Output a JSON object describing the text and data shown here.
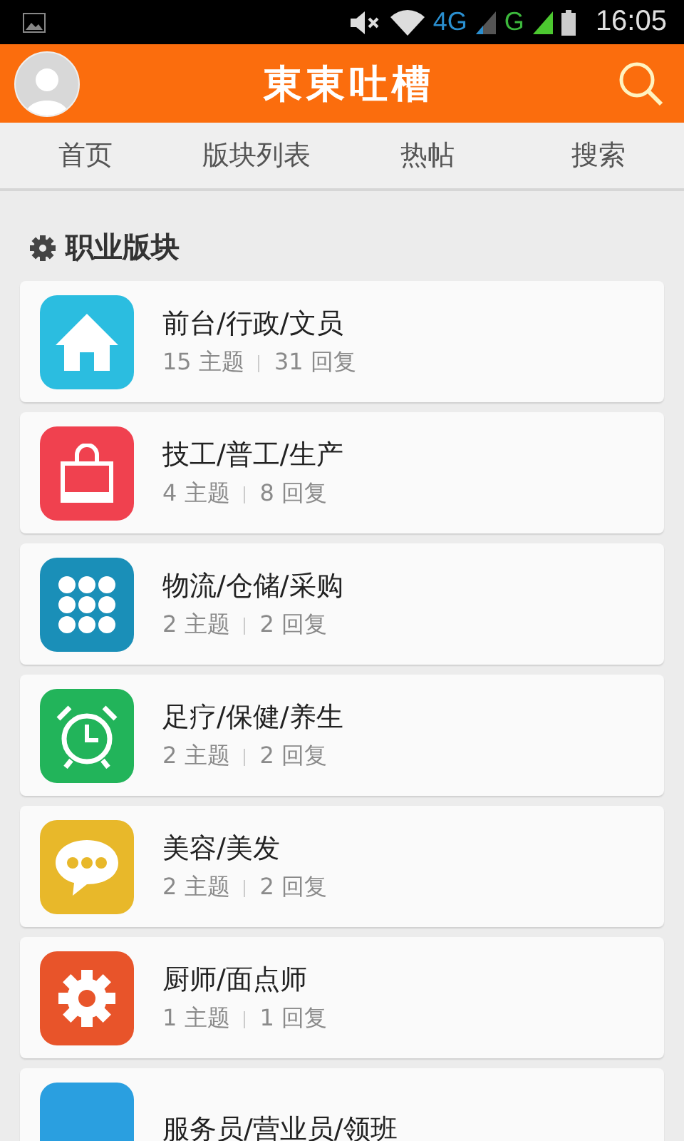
{
  "status_bar": {
    "network_1": "4G",
    "network_2": "G",
    "time": "16:05"
  },
  "header": {
    "title": "東東吐槽"
  },
  "tabs": [
    {
      "label": "首页"
    },
    {
      "label": "版块列表"
    },
    {
      "label": "热帖"
    },
    {
      "label": "搜索"
    }
  ],
  "section": {
    "title": "职业版块"
  },
  "forums": [
    {
      "kind": "house",
      "color": "#2bbde0",
      "name": "前台/行政/文员",
      "topics": "15 主题",
      "replies": "31 回复"
    },
    {
      "kind": "bag",
      "color": "#f0414f",
      "name": "技工/普工/生产",
      "topics": "4 主题",
      "replies": "8 回复"
    },
    {
      "kind": "grid",
      "color": "#1a8fb8",
      "name": "物流/仓储/采购",
      "topics": "2 主题",
      "replies": "2 回复"
    },
    {
      "kind": "alarm",
      "color": "#22b45a",
      "name": "足疗/保健/养生",
      "topics": "2 主题",
      "replies": "2 回复"
    },
    {
      "kind": "chat",
      "color": "#e8b82a",
      "name": "美容/美发",
      "topics": "2 主题",
      "replies": "2 回复"
    },
    {
      "kind": "gear",
      "color": "#e8542a",
      "name": "厨师/面点师",
      "topics": "1 主题",
      "replies": "1 回复"
    },
    {
      "kind": "other",
      "color": "#2a9fe0",
      "name": "服务员/营业员/领班"
    }
  ]
}
